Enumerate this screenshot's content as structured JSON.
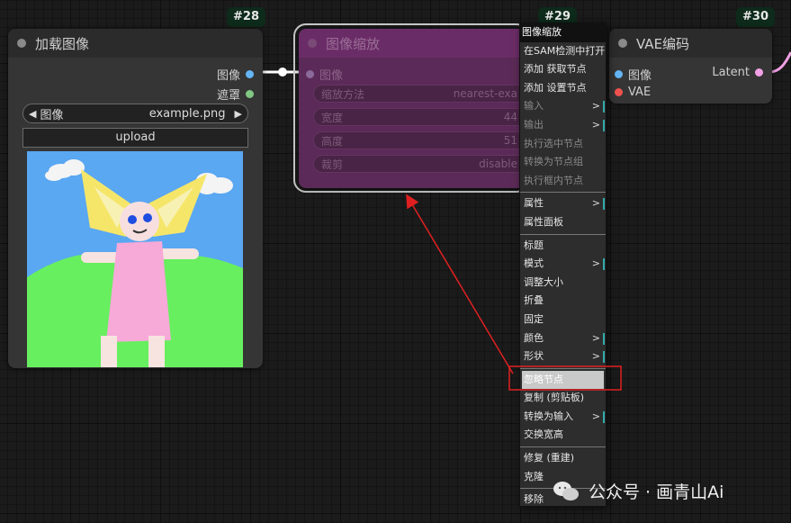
{
  "canvas": {
    "bg_color": "#1b1b1b",
    "link_color": "#ffffff",
    "accent_pink": "#f2a0e6",
    "arrow_color": "#e02020"
  },
  "badges": {
    "node28": "#28",
    "node29": "#29",
    "node30": "#30"
  },
  "load_image_node": {
    "title": "加载图像",
    "outputs": [
      {
        "label": "图像",
        "color": "#64b5f6"
      },
      {
        "label": "遮罩",
        "color": "#81c784"
      }
    ],
    "image_widget": {
      "label": "图像",
      "value": "example.png",
      "left_icon": "arrow-left-icon",
      "right_icon": "arrow-right-icon"
    },
    "upload_label": "upload",
    "preview_icon": "child-drawing-image"
  },
  "scale_node": {
    "title": "图像缩放",
    "input_label": "图像",
    "widgets": [
      {
        "label": "缩放方法",
        "value": "nearest-exa"
      },
      {
        "label": "宽度",
        "value": "44"
      },
      {
        "label": "高度",
        "value": "51"
      },
      {
        "label": "裁剪",
        "value": "disable"
      }
    ],
    "state": "bypassed"
  },
  "vae_node": {
    "title": "VAE编码",
    "inputs": [
      {
        "label": "图像",
        "color": "#64b5f6"
      },
      {
        "label": "VAE",
        "color": "#ef5350"
      }
    ],
    "output": {
      "label": "Latent",
      "color": "#f2a0e6"
    }
  },
  "context_menu": {
    "title": "图像缩放",
    "groups": [
      [
        {
          "label": "在SAM检测中打开",
          "disabled": false,
          "submenu": false
        },
        {
          "label": "添加 获取节点",
          "disabled": false,
          "submenu": false
        },
        {
          "label": "添加 设置节点",
          "disabled": false,
          "submenu": false
        },
        {
          "label": "输入",
          "disabled": true,
          "submenu": true
        },
        {
          "label": "输出",
          "disabled": true,
          "submenu": true
        },
        {
          "label": "执行选中节点",
          "disabled": true,
          "submenu": false
        },
        {
          "label": "转换为节点组",
          "disabled": true,
          "submenu": false
        },
        {
          "label": "执行框内节点",
          "disabled": true,
          "submenu": false
        }
      ],
      [
        {
          "label": "属性",
          "disabled": false,
          "submenu": true
        },
        {
          "label": "属性面板",
          "disabled": false,
          "submenu": false
        }
      ],
      [
        {
          "label": "标题",
          "disabled": false,
          "submenu": false
        },
        {
          "label": "模式",
          "disabled": false,
          "submenu": true
        },
        {
          "label": "调整大小",
          "disabled": false,
          "submenu": false
        },
        {
          "label": "折叠",
          "disabled": false,
          "submenu": false
        },
        {
          "label": "固定",
          "disabled": false,
          "submenu": false
        },
        {
          "label": "颜色",
          "disabled": false,
          "submenu": true
        },
        {
          "label": "形状",
          "disabled": false,
          "submenu": true
        }
      ],
      [
        {
          "label": "忽略节点",
          "disabled": false,
          "submenu": false,
          "highlight": true
        },
        {
          "label": "复制 (剪贴板)",
          "disabled": false,
          "submenu": false
        },
        {
          "label": "转换为输入",
          "disabled": false,
          "submenu": true
        },
        {
          "label": "交换宽高",
          "disabled": false,
          "submenu": false
        }
      ],
      [
        {
          "label": "修复 (重建)",
          "disabled": false,
          "submenu": false
        },
        {
          "label": "克隆",
          "disabled": false,
          "submenu": false
        }
      ],
      [
        {
          "label": "移除",
          "disabled": false,
          "submenu": false
        }
      ]
    ],
    "submenu_glyph": ">"
  },
  "watermark": {
    "text": "公众号 · 画青山Ai",
    "icon": "wechat-icon"
  }
}
